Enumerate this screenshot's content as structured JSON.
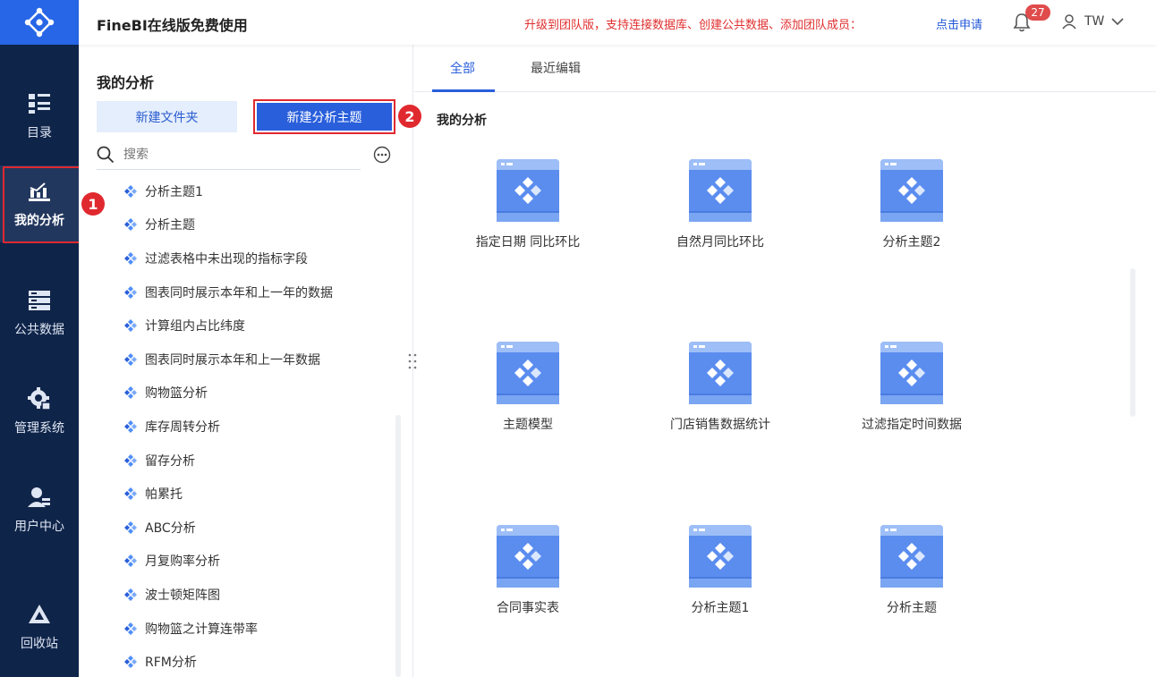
{
  "app": {
    "title": "FineBI在线版免费使用",
    "promo": "升级到团队版，支持连接数据库、创建公共数据、添加团队成员：",
    "apply_link": "点击申请",
    "notification_count": "27",
    "user_name": "TW"
  },
  "nav": {
    "items": [
      {
        "label": "目录",
        "icon": "catalog-icon"
      },
      {
        "label": "我的分析",
        "icon": "analysis-icon",
        "active": true
      },
      {
        "label": "公共数据",
        "icon": "database-icon"
      },
      {
        "label": "管理系统",
        "icon": "settings-icon"
      },
      {
        "label": "用户中心",
        "icon": "user-icon"
      },
      {
        "label": "回收站",
        "icon": "recycle-icon"
      }
    ]
  },
  "panel": {
    "title": "我的分析",
    "new_folder": "新建文件夹",
    "new_subject": "新建分析主题",
    "search_placeholder": "搜索",
    "items": [
      "分析主题1",
      "分析主题",
      "过滤表格中未出现的指标字段",
      "图表同时展示本年和上一年的数据",
      "计算组内占比纬度",
      "图表同时展示本年和上一年数据",
      "购物篮分析",
      "库存周转分析",
      "留存分析",
      "帕累托",
      "ABC分析",
      "月复购率分析",
      "波士顿矩阵图",
      "购物篮之计算连带率",
      "RFM分析"
    ]
  },
  "steps": {
    "one": "1",
    "two": "2"
  },
  "main": {
    "tabs": [
      {
        "label": "全部",
        "active": true
      },
      {
        "label": "最近编辑",
        "active": false
      }
    ],
    "section_title": "我的分析",
    "cards": [
      "指定日期 同比环比",
      "自然月同比环比",
      "分析主题2",
      "主题模型",
      "门店销售数据统计",
      "过滤指定时间数据",
      "合同事实表",
      "分析主题1",
      "分析主题"
    ]
  },
  "colors": {
    "rail_bg": "#0f2449",
    "brand_blue": "#2a5fdc",
    "highlight_red": "#e0292f"
  }
}
